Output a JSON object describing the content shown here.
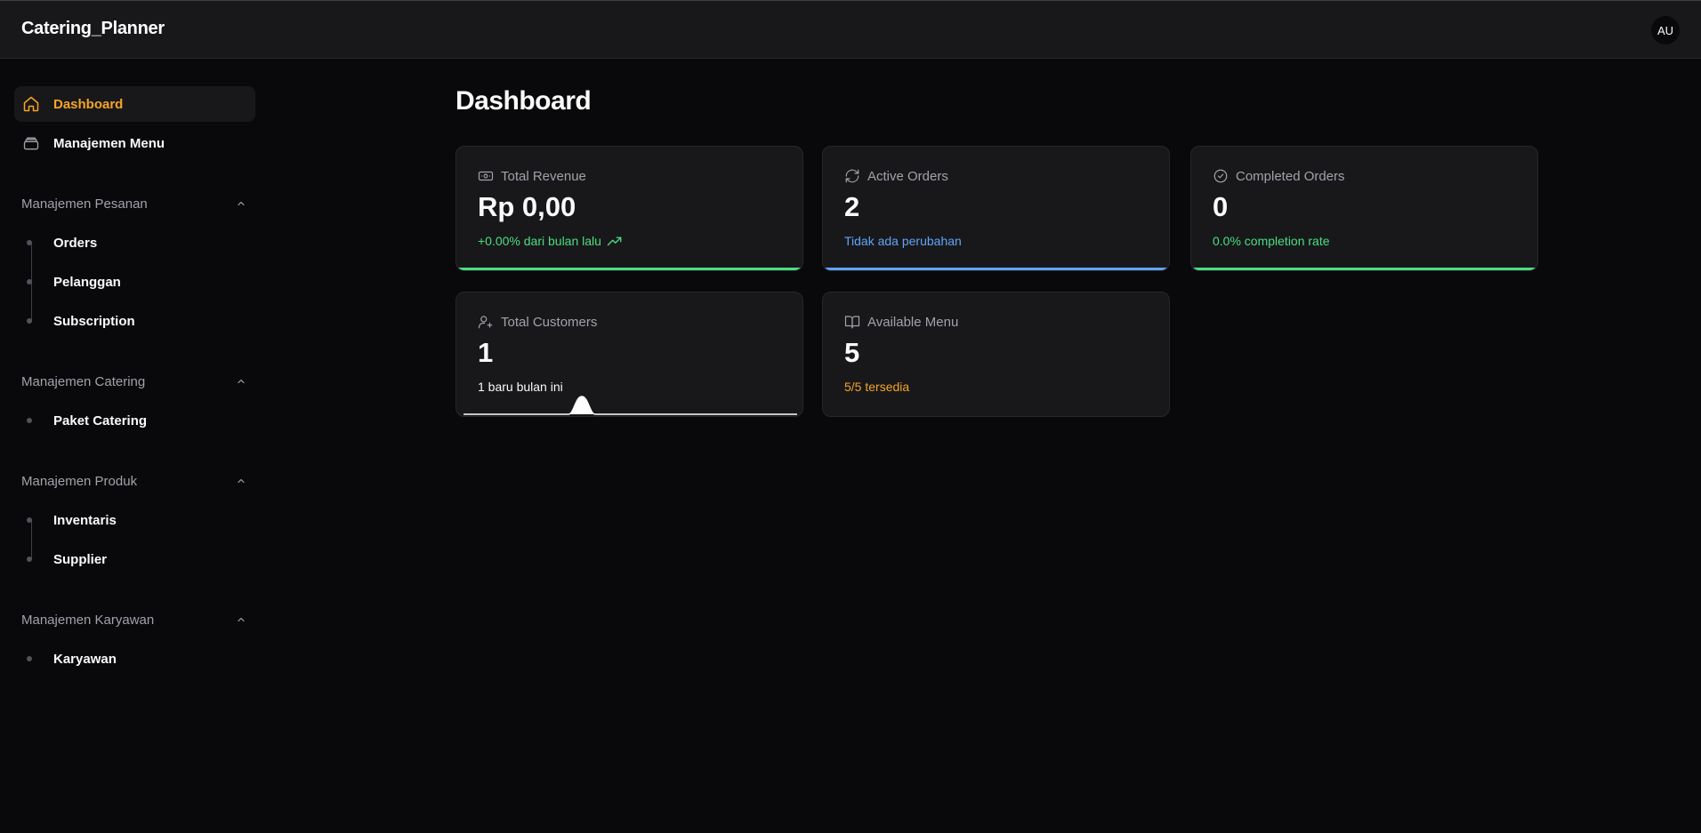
{
  "app": {
    "brand": "Catering_Planner",
    "avatar_initials": "AU"
  },
  "colors": {
    "accent": "#f5a524",
    "positive": "#4ade80",
    "info": "#60a5fa",
    "background": "#09090b",
    "surface": "#18181b"
  },
  "sidebar": {
    "top_items": [
      {
        "label": "Dashboard",
        "icon": "home-icon",
        "active": true
      },
      {
        "label": "Manajemen Menu",
        "icon": "stack-icon",
        "active": false
      }
    ],
    "groups": [
      {
        "label": "Manajemen Pesanan",
        "expanded": true,
        "items": [
          "Orders",
          "Pelanggan",
          "Subscription"
        ]
      },
      {
        "label": "Manajemen Catering",
        "expanded": true,
        "items": [
          "Paket Catering"
        ]
      },
      {
        "label": "Manajemen Produk",
        "expanded": true,
        "items": [
          "Inventaris",
          "Supplier"
        ]
      },
      {
        "label": "Manajemen Karyawan",
        "expanded": true,
        "items": [
          "Karyawan"
        ]
      }
    ]
  },
  "main": {
    "title": "Dashboard",
    "cards": [
      {
        "title": "Total Revenue",
        "icon": "banknote-icon",
        "value": "Rp 0,00",
        "subtitle": "+0.00% dari bulan lalu",
        "subtitle_icon": "trending-up-icon",
        "tone": "green"
      },
      {
        "title": "Active Orders",
        "icon": "refresh-icon",
        "value": "2",
        "subtitle": "Tidak ada perubahan",
        "tone": "blue"
      },
      {
        "title": "Completed Orders",
        "icon": "check-circle-icon",
        "value": "0",
        "subtitle": "0.0% completion rate",
        "tone": "green"
      },
      {
        "title": "Total Customers",
        "icon": "user-plus-icon",
        "value": "1",
        "subtitle": "1 baru bulan ini",
        "tone": "white"
      },
      {
        "title": "Available Menu",
        "icon": "book-open-icon",
        "value": "5",
        "subtitle": "5/5 tersedia",
        "tone": "orange"
      }
    ]
  }
}
